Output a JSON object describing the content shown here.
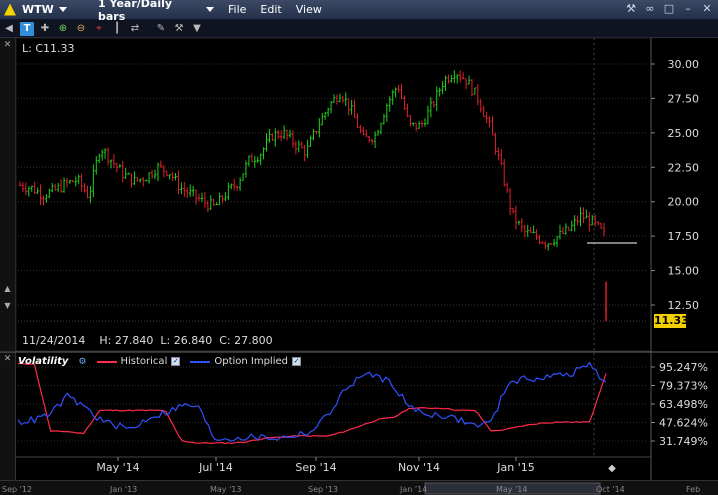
{
  "titlebar": {
    "symbol": "WTW",
    "period": "1 Year/Daily bars",
    "menus": [
      "File",
      "Edit",
      "View"
    ],
    "right_icons": [
      "wrench-icon",
      "link-icon",
      "lock-icon",
      "minimize-icon",
      "close-icon"
    ]
  },
  "toolbar": {
    "tools": [
      "text-tool-icon",
      "crosshair-icon",
      "zoom-in-icon",
      "zoom-out-icon",
      "crosshair-red-icon",
      "split-icon",
      "arrows-icon",
      "draw-icon",
      "settings-icon",
      "dropdown-icon"
    ]
  },
  "price_panel": {
    "label": "L: C11.33",
    "ohlc_date": "11/24/2014",
    "ohlc_high": "H: 27.840",
    "ohlc_low": "L: 26.840",
    "ohlc_close": "C: 27.800",
    "last_price": "11.33",
    "colors": {
      "up": "#1fd01f",
      "down": "#e0202e",
      "grid": "#333333"
    }
  },
  "volatility_panel": {
    "title": "Volatility",
    "historical_label": "Historical",
    "implied_label": "Option Implied",
    "colors": {
      "historical": "#ff2a4a",
      "implied": "#3050ff"
    }
  },
  "chart_data": [
    {
      "type": "candlestick",
      "y_ticks": [
        "30.00",
        "27.50",
        "25.00",
        "22.50",
        "20.00",
        "17.50",
        "15.00",
        "12.50"
      ],
      "ylim": [
        10.5,
        31.5
      ],
      "x_ticks": [
        "May '14",
        "Jul '14",
        "Sep '14",
        "Nov '14",
        "Jan '15"
      ],
      "series_close": [
        21.2,
        21.0,
        20.5,
        20.8,
        21.3,
        21.6,
        20.4,
        24.0,
        23.0,
        22.0,
        21.5,
        21.8,
        22.5,
        22.2,
        21.0,
        20.5,
        20.0,
        19.6,
        20.6,
        21.4,
        23.0,
        23.5,
        24.8,
        25.0,
        24.2,
        23.6,
        25.5,
        27.0,
        28.0,
        26.5,
        24.5,
        24.8,
        27.0,
        28.5,
        25.5,
        25.5,
        27.0,
        28.8,
        29.5,
        28.8,
        27.5,
        25.5,
        22.5,
        19.0,
        17.8,
        17.5,
        17.0,
        17.5,
        18.0,
        19.0,
        18.5,
        17.6,
        11.33
      ],
      "last": 11.33,
      "reference_line": 17.0
    },
    {
      "type": "line",
      "y_ticks": [
        "95.247%",
        "79.373%",
        "63.498%",
        "47.624%",
        "31.749%"
      ],
      "ylim": [
        25,
        100
      ],
      "series": [
        {
          "name": "Historical",
          "values": [
            98,
            98,
            40,
            40,
            38,
            58,
            58,
            58,
            58,
            58,
            32,
            30,
            30,
            30,
            31,
            34,
            35,
            36,
            36,
            36,
            40,
            45,
            50,
            52,
            60,
            60,
            60,
            58,
            58,
            40,
            42,
            45,
            47,
            48,
            48,
            48,
            90
          ]
        },
        {
          "name": "Option Implied",
          "values": [
            48,
            50,
            55,
            70,
            62,
            50,
            45,
            42,
            52,
            56,
            62,
            62,
            34,
            34,
            35,
            35,
            34,
            37,
            40,
            55,
            75,
            88,
            88,
            80,
            60,
            55,
            54,
            50,
            45,
            48,
            82,
            85,
            86,
            88,
            90,
            99,
            80
          ]
        }
      ]
    }
  ],
  "bottom_scroll": {
    "labels": [
      "Sep '12",
      "Jan '13",
      "May '13",
      "Sep '13",
      "Jan '14",
      "May '14",
      "Oct '14",
      "Feb"
    ]
  }
}
